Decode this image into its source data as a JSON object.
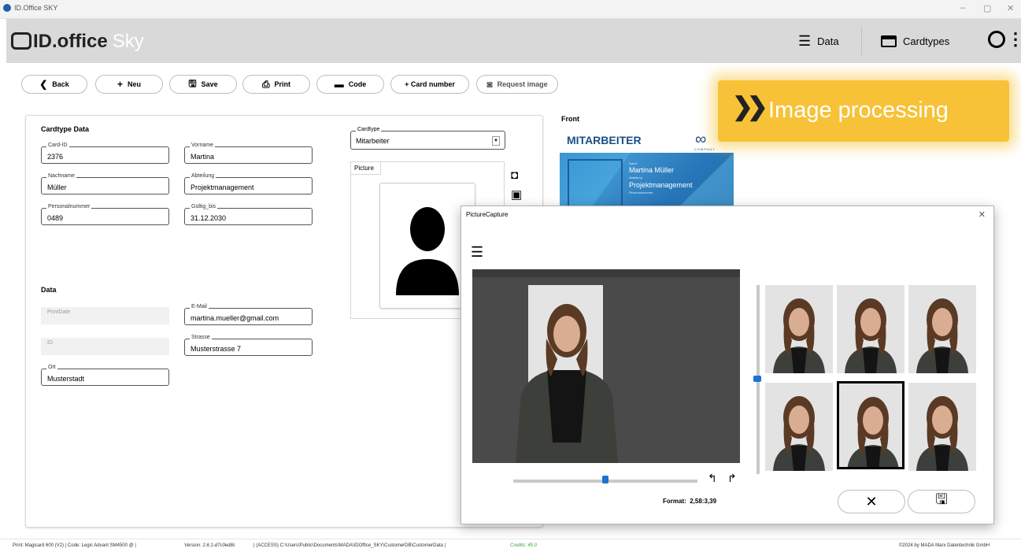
{
  "window": {
    "title": "ID.Office SKY",
    "controls": [
      "–",
      "▢",
      "✕"
    ]
  },
  "app": {
    "logo_main": "ID.office",
    "logo_sub": "Sky"
  },
  "nav": {
    "data_label": "Data",
    "cardtypes_label": "Cardtypes"
  },
  "toolbar": {
    "back": "Back",
    "neu": "Neu",
    "save": "Save",
    "print": "Print",
    "code": "Code",
    "card_number": "+ Card number",
    "request_image": "Request image"
  },
  "form": {
    "cardtype_section": "Cardtype Data",
    "data_section": "Data",
    "fields": {
      "card_id": {
        "label": "Card-ID",
        "value": "2376"
      },
      "vorname": {
        "label": "Vorname",
        "value": "Martina"
      },
      "nachname": {
        "label": "Nachname",
        "value": "Müller"
      },
      "abteilung": {
        "label": "Abteilung",
        "value": "Projektmanagement"
      },
      "personalnummer": {
        "label": "Personalnummer",
        "value": "0489"
      },
      "gueltig_bis": {
        "label": "Gültig_bis",
        "value": "31.12.2030"
      },
      "printdate": {
        "label": "PrintDate",
        "value": ""
      },
      "email": {
        "label": "E-Mail",
        "value": "martina.mueller@gmail.com"
      },
      "id": {
        "label": "ID",
        "value": ""
      },
      "strasse": {
        "label": "Strasse",
        "value": "Musterstrasse 7"
      },
      "ort": {
        "label": "Ort",
        "value": "Musterstadt"
      }
    },
    "cardtype": {
      "label": "Cardtype",
      "value": "Mitarbeiter"
    },
    "picture_tab": "Picture"
  },
  "preview": {
    "front_label": "Front",
    "card_title": "MITARBEITER",
    "card_logo_sub": "COMPANY",
    "card_label_name": "Name",
    "card_name": "Martina Müller",
    "card_label_dept": "Abteilung",
    "card_dept": "Projektmanagement",
    "card_label_pnr": "Personalnummer"
  },
  "banner": {
    "arrows": "❯❯",
    "text": "Image processing",
    "color": "#f7c237"
  },
  "dialog": {
    "title": "PictureCapture",
    "format_label": "Format:",
    "format_value": "2,58:3,39",
    "zoom_level": 0.5,
    "selected_thumbnail": 5
  },
  "statusbar": {
    "print": "Print:  Magicard 600 (V2)  |  Code:  Legic Advant SM4500 @  |",
    "version": "Version:  2.6.1-d7c0ed8c",
    "path": "|  (ACCESS) C:\\Users\\Public\\Documents\\MADA\\IDOffice_SKY\\CustomerDB\\CustomerData  |",
    "credits": "Credits: 45.0",
    "copyright": "©2024 by MADA Marx Datentechnik GmbH"
  }
}
